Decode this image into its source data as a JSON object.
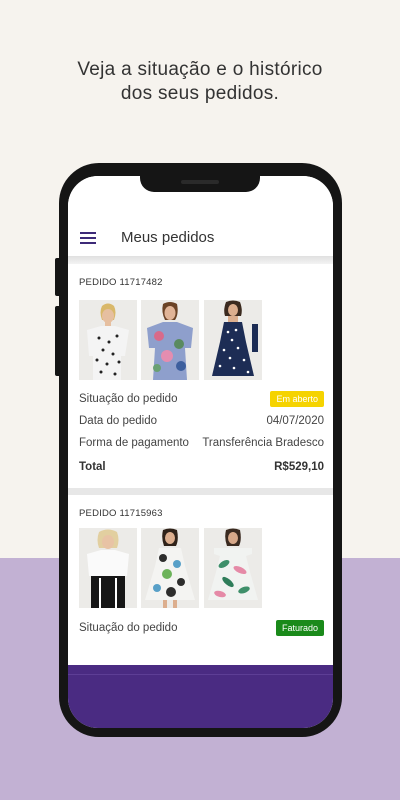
{
  "promo": {
    "headline_line1": "Veja a situação e o histórico",
    "headline_line2": "dos seus pedidos."
  },
  "appbar": {
    "menu_icon": "hamburger-menu-icon",
    "title": "Meus pedidos"
  },
  "orders": [
    {
      "number_label": "PEDIDO 11717482",
      "status_label": "Situação do pedido",
      "status_badge": "Em aberto",
      "status_color": "#f5d300",
      "date_label": "Data do pedido",
      "date_value": "04/07/2020",
      "payment_label": "Forma de pagamento",
      "payment_value": "Transferência Bradesco",
      "total_label": "Total",
      "total_value": "R$529,10",
      "products": [
        "polka-dot-blouse-photo",
        "floral-blouse-photo",
        "polka-dot-dress-photo"
      ]
    },
    {
      "number_label": "PEDIDO 11715963",
      "status_label": "Situação do pedido",
      "status_badge": "Faturado",
      "status_color": "#1a8a1a",
      "products": [
        "white-top-black-pants-photo",
        "floral-dress-photo",
        "leaf-print-dress-photo"
      ]
    }
  ],
  "colors": {
    "brand_purple": "#4a2b82",
    "background_lilac": "#c2b1d3",
    "background_cream": "#f6f3ee"
  }
}
